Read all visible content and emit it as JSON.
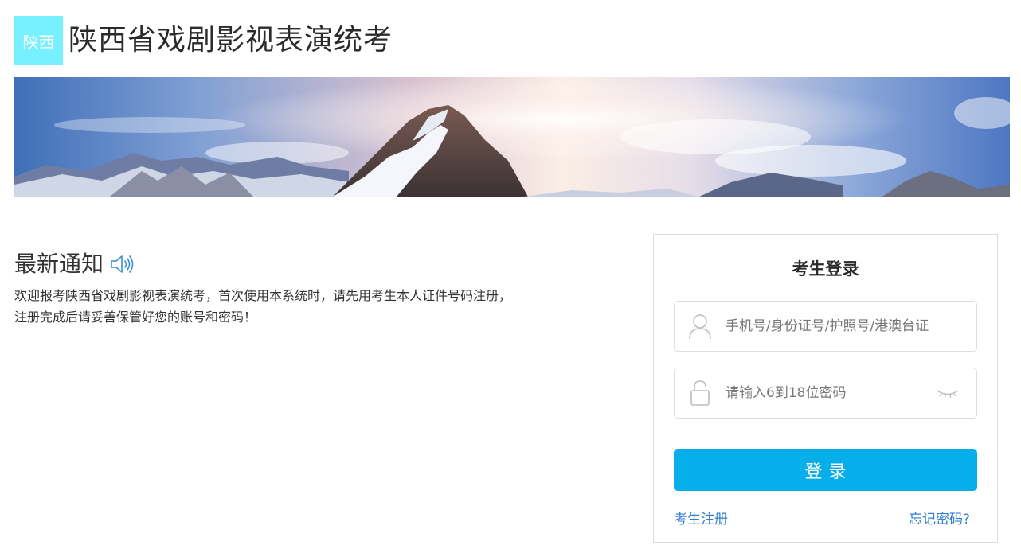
{
  "header": {
    "logo_text": "陕西",
    "site_title": "陕西省戏剧影视表演统考",
    "logo_color": "#77f0ff"
  },
  "banner": {
    "description_icon": "mountain-banner-image"
  },
  "notice": {
    "title": "最新通知",
    "icon": "speaker-icon",
    "lines": [
      "欢迎报考陕西省戏剧影视表演统考，首次使用本系统时，请先用考生本人证件号码注册，",
      "注册完成后请妥善保管好您的账号和密码！"
    ]
  },
  "login": {
    "title": "考生登录",
    "account": {
      "value": "",
      "placeholder": "手机号/身份证号/护照号/港澳台证",
      "icon": "user-icon"
    },
    "password": {
      "value": "",
      "placeholder": "请输入6到18位密码",
      "icon": "lock-icon",
      "toggle_icon": "eye-closed-icon"
    },
    "submit_label": "登录",
    "register_link": "考生注册",
    "forgot_link": "忘记密码?",
    "accent_color": "#06aeea",
    "link_color": "#2f7fd0"
  }
}
